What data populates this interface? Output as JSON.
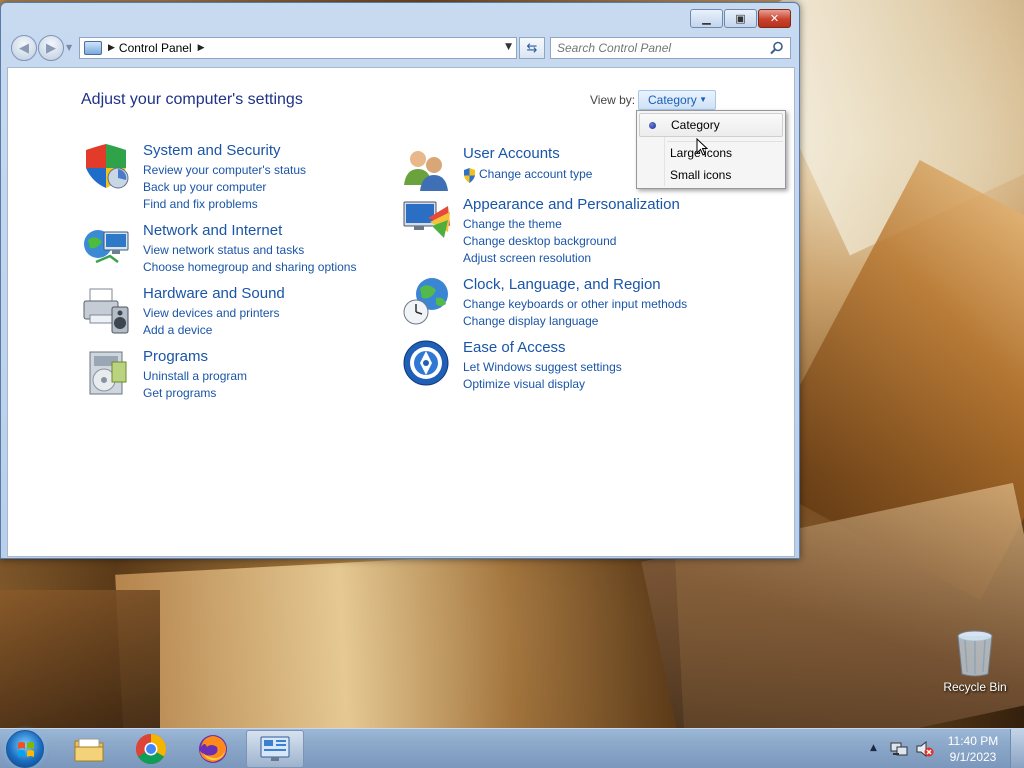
{
  "window": {
    "minimize_label": "▁",
    "maximize_label": "▣",
    "close_label": "✕"
  },
  "navigation": {
    "breadcrumb": "Control Panel",
    "search_placeholder": "Search Control Panel"
  },
  "main": {
    "title": "Adjust your computer's settings",
    "view_by_label": "View by:",
    "view_by_value": "Category"
  },
  "categories": [
    {
      "title": "System and Security",
      "icon": "shield-icon",
      "links": [
        "Review your computer's status",
        "Back up your computer",
        "Find and fix problems"
      ]
    },
    {
      "title": "Network and Internet",
      "icon": "network-globe-icon",
      "links": [
        "View network status and tasks",
        "Choose homegroup and sharing options"
      ]
    },
    {
      "title": "Hardware and Sound",
      "icon": "printer-speaker-icon",
      "links": [
        "View devices and printers",
        "Add a device"
      ]
    },
    {
      "title": "Programs",
      "icon": "programs-box-icon",
      "links": [
        "Uninstall a program",
        "Get programs"
      ]
    },
    {
      "title": "User Accounts",
      "icon": "users-icon",
      "links": [
        "Change account type"
      ]
    },
    {
      "title": "Appearance and Personalization",
      "icon": "monitor-palette-icon",
      "links": [
        "Change the theme",
        "Change desktop background",
        "Adjust screen resolution"
      ]
    },
    {
      "title": "Clock, Language, and Region",
      "icon": "clock-globe-icon",
      "links": [
        "Change keyboards or other input methods",
        "Change display language"
      ]
    },
    {
      "title": "Ease of Access",
      "icon": "ease-of-access-icon",
      "links": [
        "Let Windows suggest settings",
        "Optimize visual display"
      ]
    }
  ],
  "view_menu": {
    "items": [
      "Category",
      "Large icons",
      "Small icons"
    ],
    "selected": "Category"
  },
  "desktop": {
    "recycle_bin_label": "Recycle Bin"
  },
  "taskbar": {
    "apps": [
      "file-explorer-icon",
      "chrome-icon",
      "firefox-icon",
      "control-panel-icon"
    ],
    "time": "11:40 PM",
    "date": "9/1/2023"
  }
}
